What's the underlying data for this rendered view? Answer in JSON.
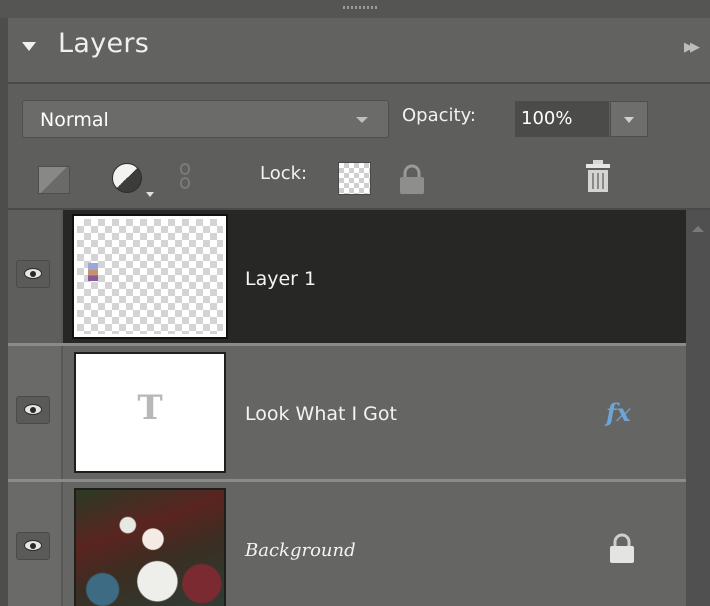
{
  "panel": {
    "title": "Layers"
  },
  "blend_mode": {
    "selected": "Normal"
  },
  "opacity": {
    "label": "Opacity:",
    "value": "100%"
  },
  "lock": {
    "label": "Lock:"
  },
  "layers": [
    {
      "name": "Layer 1",
      "selected": true,
      "visible": true,
      "thumbnail": "transparent-with-sticker"
    },
    {
      "name": "Look What I Got",
      "selected": false,
      "visible": true,
      "thumbnail": "text-layer",
      "badge": "fx"
    },
    {
      "name": "Background",
      "selected": false,
      "visible": true,
      "thumbnail": "photo",
      "locked": true
    }
  ],
  "colors": {
    "panel_bg": "#5e5e5c",
    "selected_row": "#272725",
    "fx_blue": "#6fa4d6"
  }
}
